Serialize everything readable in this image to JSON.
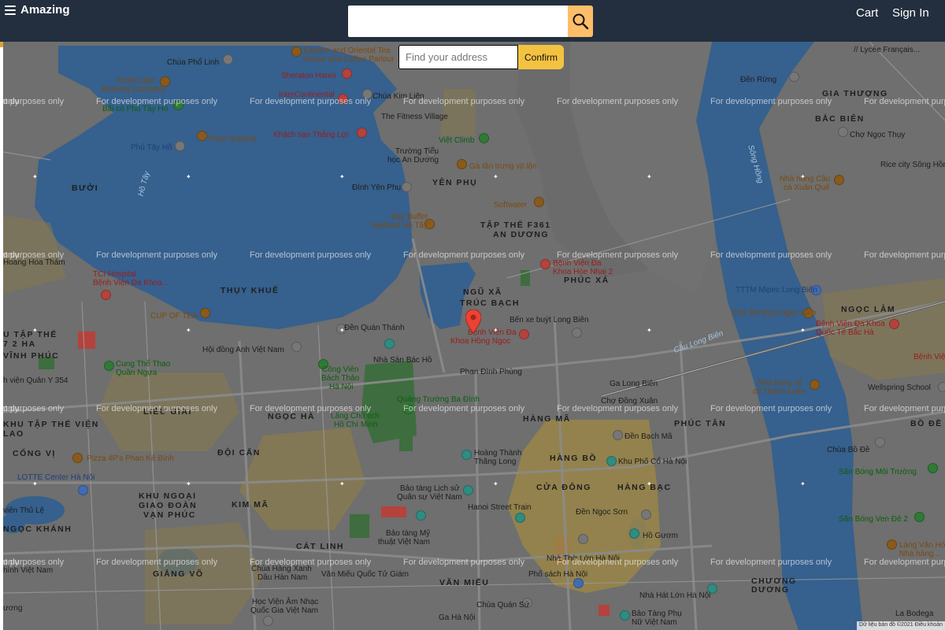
{
  "header": {
    "brand": "Amazing",
    "cart": "Cart",
    "sign_in": "Sign In",
    "search_value": ""
  },
  "address": {
    "placeholder": "Find your address",
    "confirm": "Confirm"
  },
  "map": {
    "watermark": "For development purposes only",
    "watermark_partial": "only",
    "attribution": "Dữ liệu bản đồ ©2021   Điều khoản",
    "areas": {
      "buoi": "BƯỞI",
      "yen_phu": "YÊN PHỤ",
      "tap_the_f361": "TẬP THỂ F361",
      "an_duong": "AN DƯƠNG",
      "thuy_khue": "THỤY KHUÊ",
      "ngu_xa": "NGŨ XÃ",
      "truc_bach": "TRÚC BẠCH",
      "phuc_xa": "PHÚC XÁ",
      "ngoc_ha": "NGỌC HÀ",
      "lieu_giai": "LIỄU GIAI",
      "hang_ma": "HÀNG MÃ",
      "phuc_tan": "PHÚC TÂN",
      "doi_can": "ĐỘI CẤN",
      "cong_vi": "CỐNG VỊ",
      "khu_tap_the_vien_lao": "KHU TẬP THỂ VIỆN LAO",
      "khu_ngoai_giao_doan": "KHU NGOẠI GIAO ĐOÀN",
      "van_phuc": "VẠN PHÚC",
      "kim_ma": "KIM MÃ",
      "hang_bo": "HÀNG BỒ",
      "hang_bac": "HÀNG BẠC",
      "cua_dong": "CỬA ĐÔNG",
      "cat_linh": "CÁT LINH",
      "giang_vo": "GIẢNG VÕ",
      "van_mieu": "VĂN MIẾU",
      "ngoc_khanh": "NGỌC KHÁNH",
      "vinh_phuc": "VĨNH PHÚC",
      "chuong_duong": "CHƯƠNG DƯƠNG",
      "bac_bien": "BẮC BIÊN",
      "gia_thuong": "GIA THƯỢNG",
      "ngoc_lam": "NGỌC LÂM",
      "bo_de": "BỒ ĐỀ",
      "tu_tap_the_72_ha": "U TẬP THỂ 7 2 HA"
    },
    "pois": {
      "chua_pho_linh": "Chùa Phổ Linh",
      "eastern_oriental": "Eastern and Oriental Tea",
      "house_coffee": "House and Coffee Parlour",
      "sheraton": "Sheraton Hanoi",
      "turtle_lake": "Turtle Lake",
      "brewing": "Brewing Company",
      "bai_co_phu_tay_ho": "Bãi cỏ Phủ Tây Hồ",
      "intercontinental": "InterContinental",
      "chua_kim_lien": "Chùa Kim Liên",
      "fitness_village": "The Fitness Village",
      "phu_tay_ho": "Phủ Tây Hồ",
      "pepe": "Pepe la poule",
      "khach_san_thang_loi": "Khách sạn Thắng Lợi",
      "viet_climb": "Việt Climb",
      "truong_tieu": "Trường Tiểu",
      "hoc_an_duong": "học An Dương",
      "ga_tan": "Gà tần trưng vịt lộn",
      "dinh_yen_phu": "Đình Yên Phụ",
      "softwater": "Softwater",
      "bay_buffet": "Bay Buffet",
      "seafood_ho_tay": "Seafood Hồ Tây",
      "hoang_hoa_tham": "Hoàng Hoa Thám",
      "tci_hospital": "TCI Hospital",
      "benh_vien_da_khoa": "Bệnh Viện Đa Khoa...",
      "bv_da_khoa_hoe_nhai_1": "Bệnh Viện Đa",
      "bv_da_khoa_hoe_nhai_2": "Khoa Hòe Nhai 2",
      "cup_of_tea": "CUP OF TEA",
      "den_quan_thanh": "Đền Quán Thánh",
      "bv_hong_ngoc_1": "Bệnh Viện Đa",
      "bv_hong_ngoc_2": "Khoa Hồng Ngọc",
      "ben_xe_long_bien": "Bến xe buýt Long Biên",
      "hoi_dong_anh": "Hội đồng Anh Việt Nam",
      "nha_san_bac_ho": "Nhà Sàn Bác Hồ",
      "cung_the_thao_1": "Cung Thể Thao",
      "cung_the_thao_2": "Quần Ngựa",
      "cong_vien_1": "Công Viên",
      "cong_vien_2": "Bách Thảo",
      "cong_vien_3": "Hà Nội",
      "quang_truong": "Quảng Trường Ba Đình",
      "lang_chu_tich_1": "Lăng Chủ tịch",
      "lang_chu_tich_2": "Hồ Chí Minh",
      "ga_long_bien": "Ga Long Biên",
      "cho_dong_xuan": "Chợ Đồng Xuân",
      "den_bach_ma": "Đền Bạch Mã",
      "khu_pho_co": "Khu Phố Cổ Hà Nội",
      "pizza_4ps": "Pizza 4P's Phan Kế Bính",
      "lotte": "LOTTE Center Hà Nội",
      "hoang_thanh_1": "Hoàng Thành",
      "hoang_thanh_2": "Thăng Long",
      "bao_tang_lich_su_1": "Bảo tàng Lịch sử",
      "bao_tang_lich_su_2": "Quân sự Việt Nam",
      "hanoi_street_train": "Hanoi Street Train",
      "den_ngoc_son": "Đền Ngọc Sơn",
      "ho_guom": "Hồ Gươm",
      "bao_tang_my_thuat_1": "Bảo tàng Mỹ",
      "bao_tang_my_thuat_2": "thuật Việt Nam",
      "nha_tho_lon": "Nhà Thờ Lớn Hà Nội",
      "pho_sach": "Phố sách Hà Nội",
      "chua_hang_xanh_1": "Chùa Hàng Xanh",
      "chua_hang_xanh_2": "Dâu Hàn Nam",
      "van_mieu_qtg": "Văn Miếu Quốc Tử Giám",
      "hoc_vien_am_nhac_1": "Học Viện Âm Nhạc",
      "hoc_vien_am_nhac_2": "Quốc Gia Việt Nam",
      "chua_quan_su": "Chùa Quán Sứ",
      "ga_ha_noi": "Ga Hà Nội",
      "nha_hat_lon": "Nhà Hát Lớn Hà Nội",
      "bao_tang_phu_nu_1": "Bảo Tàng Phụ",
      "bao_tang_phu_nu_2": "Nữ Việt Nam",
      "cho_ngoc_thuy": "Chợ Ngọc Thụy",
      "rice_city": "Rice city Sông Hồng",
      "nha_hang_cau_1": "Nhà hàng Cầu",
      "nha_hang_cau_2": "cá Xuân Quê",
      "den_rung": "Đền Rừng",
      "lycee": "// Lycée Français...",
      "ttm_mipec": "TTTM Mipec Long Biên",
      "cho_am_thuc": "Chợ ẩm thực Ngọc Lâm",
      "bv_duc_bac_ha_1": "Bệnh Viện Đa Khoa",
      "bv_duc_bac_ha_2": "Quốc Tế Bắc Hà",
      "nha_hang_ve_1": "Nhà hàng vé",
      "nha_hang_ve_2": "cổ Thành Luân",
      "wellspring": "Wellspring School",
      "chua_bo_de": "Chùa Bồ Đề",
      "san_bong_moi_truong": "Sân Bóng Môi Trường",
      "san_bong_ven_de": "Sân Bóng Ven Đê 2",
      "lang_van_hoa_1": "Làng Văn Hóa",
      "lang_van_hoa_2": "Nhà hàng...",
      "la_bodega": "La Bodega",
      "ho_tay_label": "Hồ Tây",
      "phan_dinh_phung": "Phan Đình Phùng",
      "cau_long_bien": "Cầu Long Biên",
      "song_hong": "Sông Hồng",
      "benh_vien_quan_y": "h viện Quân Y 354",
      "vien_thu_le": "viên Thủ Lệ",
      "hinh_viet_nam": "hình Việt Nam",
      "uong": "ương",
      "benh_vien_khoa_t": "Bệnh Viện Khoa T"
    }
  }
}
